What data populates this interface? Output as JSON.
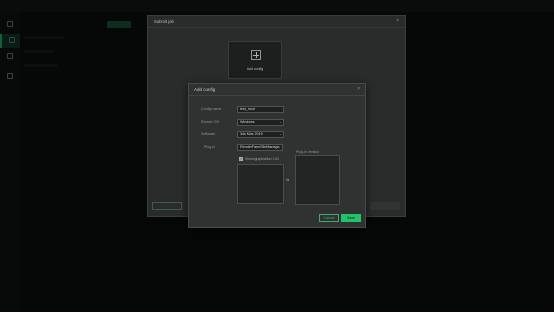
{
  "submit_job": {
    "title": "Submit job",
    "close_glyph": "×",
    "add_config_label": "Add config"
  },
  "add_config": {
    "title": "Add config",
    "close_glyph": "×",
    "config_name": {
      "label": "Config name",
      "value": "test_mod"
    },
    "render_os": {
      "label": "Render OS",
      "value": "Windows"
    },
    "software": {
      "label": "Software",
      "value": "3ds Max 2019"
    },
    "plugin": {
      "label": "Plug-in",
      "value": "RenderFarmSiteManage"
    },
    "checkbox_label": "StereographicMax 2.82",
    "plugin_version_label": "Plug-in version",
    "transfer_glyph": "⇆",
    "cancel_label": "Cancel",
    "save_label": "Save"
  },
  "icons": {
    "close": "close-icon",
    "plus": "plus-icon",
    "chevron": "chevron-down-icon",
    "transfer": "transfer-arrows-icon"
  },
  "colors": {
    "accent": "#22c36b",
    "dialog_bg": "#303232",
    "page_bg": "#0d0e0e"
  }
}
